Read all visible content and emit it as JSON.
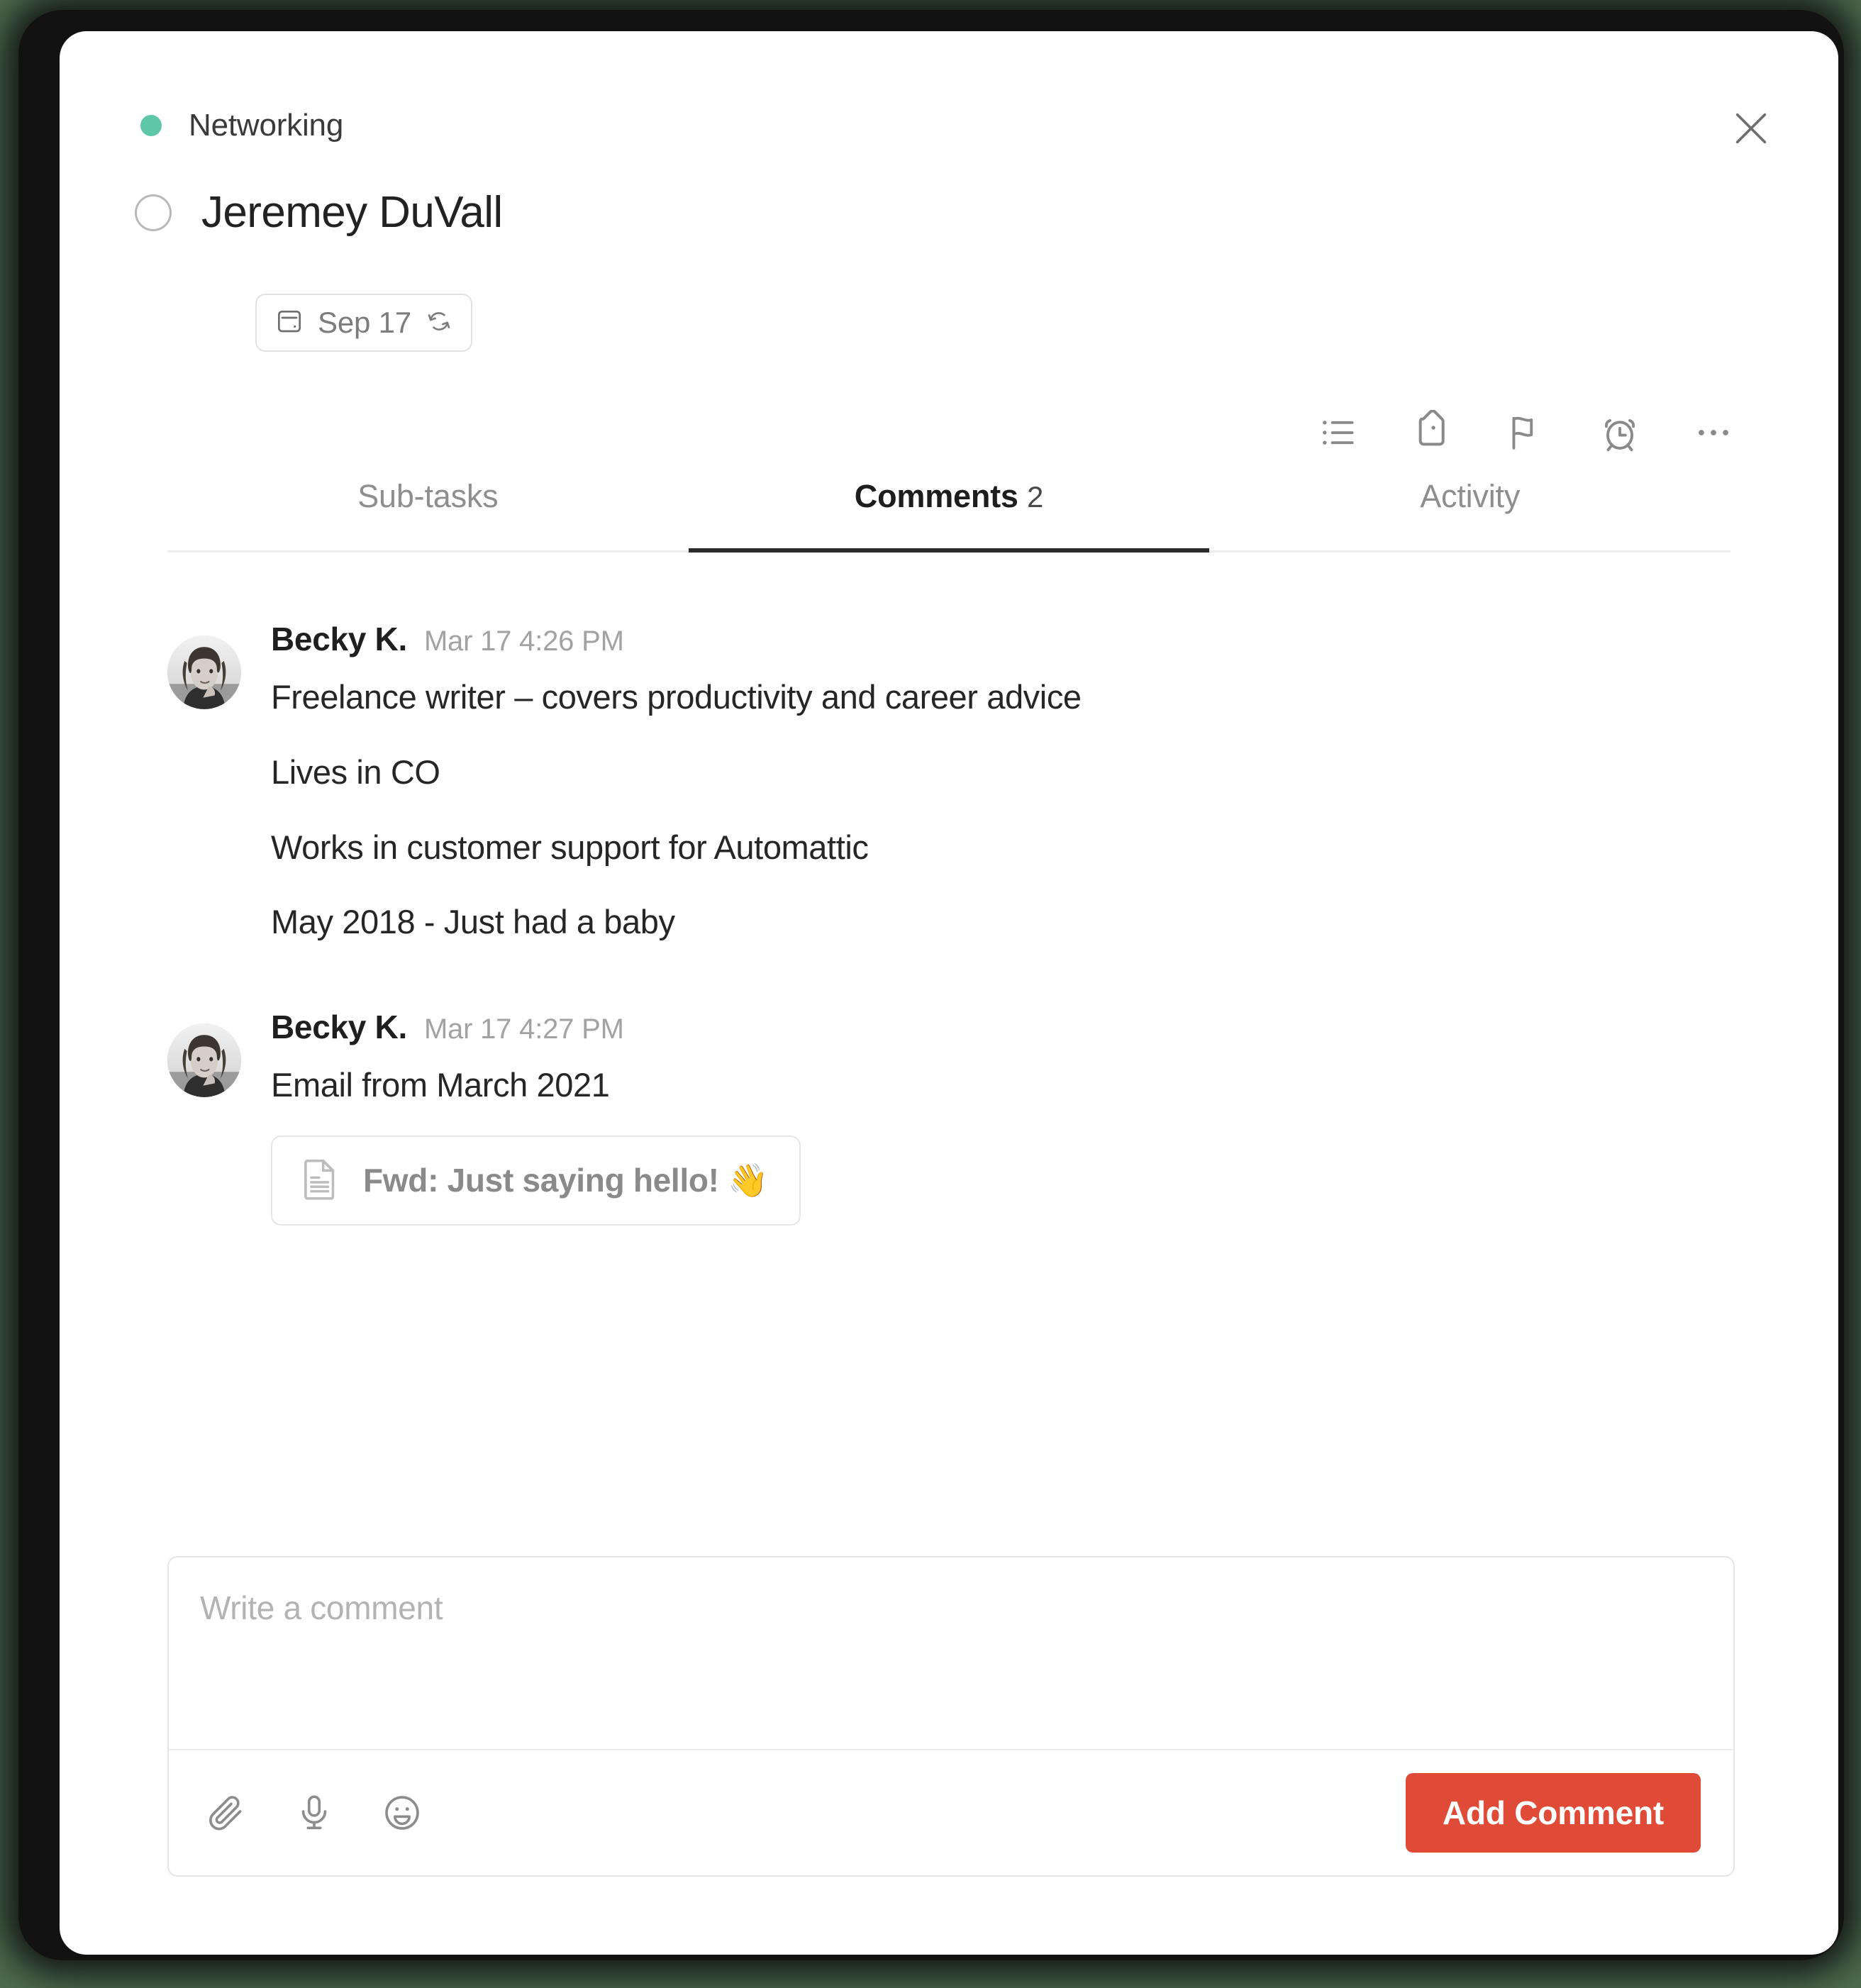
{
  "colors": {
    "project_dot": "#5ec7a7",
    "accent_button": "#df4b36",
    "frame": "#121212",
    "backdrop": "#4d6b4f"
  },
  "header": {
    "project_name": "Networking",
    "close_icon": "close-icon"
  },
  "task": {
    "title": "Jeremey DuVall",
    "checkbox_state": "unchecked",
    "due_date": "Sep 17",
    "due_icon": "calendar-icon",
    "recurring_icon": "repeat-icon"
  },
  "toolbar": [
    {
      "name": "subtasks-icon",
      "label": "Sub-tasks"
    },
    {
      "name": "tag-icon",
      "label": "Tags"
    },
    {
      "name": "flag-icon",
      "label": "Priority"
    },
    {
      "name": "reminder-icon",
      "label": "Reminder"
    },
    {
      "name": "more-icon",
      "label": "More"
    }
  ],
  "tabs": [
    {
      "label": "Sub-tasks",
      "count": "",
      "active": false
    },
    {
      "label": "Comments",
      "count": "2",
      "active": true
    },
    {
      "label": "Activity",
      "count": "",
      "active": false
    }
  ],
  "comments": [
    {
      "author": "Becky K.",
      "timestamp": "Mar 17 4:26 PM",
      "avatar": "avatar",
      "lines": [
        "Freelance writer – covers productivity and career advice",
        "Lives in CO",
        "Works in customer support for Automattic",
        "May 2018 - Just had a baby"
      ],
      "attachment": null
    },
    {
      "author": "Becky K.",
      "timestamp": "Mar 17 4:27 PM",
      "avatar": "avatar",
      "lines": [
        "Email from March 2021"
      ],
      "attachment": {
        "icon": "document-icon",
        "name": "Fwd: Just saying hello! 👋"
      }
    }
  ],
  "composer": {
    "placeholder": "Write a comment",
    "value": "",
    "icons": [
      {
        "name": "paperclip-icon",
        "label": "Attach file"
      },
      {
        "name": "microphone-icon",
        "label": "Record audio"
      },
      {
        "name": "emoji-icon",
        "label": "Insert emoji"
      }
    ],
    "submit_label": "Add Comment"
  }
}
